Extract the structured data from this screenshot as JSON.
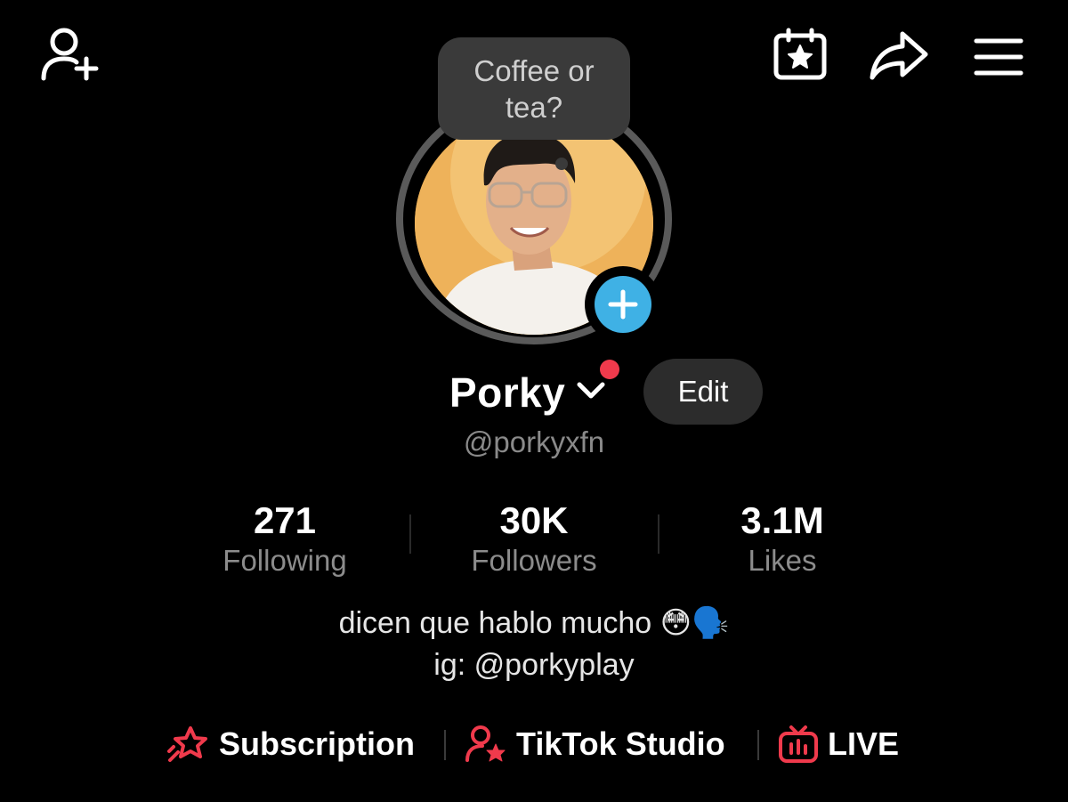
{
  "topbar": {
    "left_icon": "add-friend-icon",
    "right_icons": [
      "calendar-star-icon",
      "share-icon",
      "menu-icon"
    ]
  },
  "profile": {
    "note_text": "Coffee or tea?",
    "display_name": "Porky",
    "edit_label": "Edit",
    "username": "@porkyxfn"
  },
  "stats": [
    {
      "value": "271",
      "label": "Following"
    },
    {
      "value": "30K",
      "label": "Followers"
    },
    {
      "value": "3.1M",
      "label": "Likes"
    }
  ],
  "bio": {
    "line1": "dicen que hablo mucho 😳🗣️",
    "line2": "ig: @porkyplay"
  },
  "links": [
    {
      "label": "Subscription",
      "icon": "subscription-star-icon"
    },
    {
      "label": "TikTok Studio",
      "icon": "studio-person-icon"
    },
    {
      "label": "LIVE",
      "icon": "live-tv-icon"
    }
  ],
  "colors": {
    "background": "#000000",
    "accent_red": "#f03a4c",
    "add_blue": "#3fb1e5",
    "muted_text": "#8a8a8a"
  }
}
